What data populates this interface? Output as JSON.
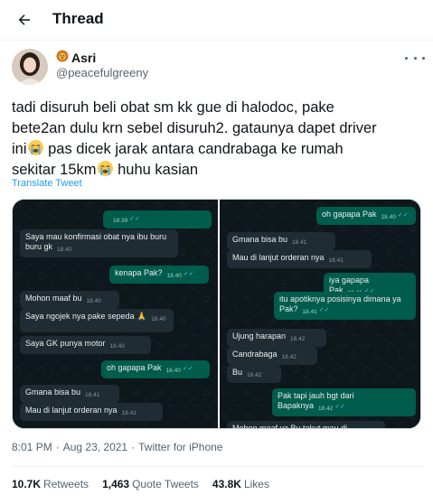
{
  "header": {
    "title": "Thread"
  },
  "author": {
    "name": "Asri",
    "handle": "@peacefulgreeny"
  },
  "tweet": {
    "text_line1": "tadi disuruh beli obat sm kk gue di halodoc, pake",
    "text_line2": "bete2an dulu krn sebel disuruh2. gataunya dapet driver",
    "text_line3_a": "ini",
    "text_line3_b": " pas dicek jarak antara candrabaga ke rumah",
    "text_line4_a": "sekitar 15km",
    "text_line4_b": " huhu kasian",
    "translate_label": "Translate Tweet"
  },
  "chat_left": [
    {
      "dir": "out",
      "text": "",
      "time": "18.39"
    },
    {
      "dir": "in",
      "text": "Saya mau konfirmasi obat nya ibu buru buru gk",
      "time": "18.40"
    },
    {
      "dir": "out",
      "text": "kenapa Pak?",
      "time": "18.40"
    },
    {
      "dir": "in",
      "text": "Mohon maaf bu",
      "time": "18.40"
    },
    {
      "dir": "in",
      "text": "Saya ngojek nya pake sepeda 🙏",
      "time": "18.40"
    },
    {
      "dir": "in",
      "text": "Saya GK punya motor",
      "time": "18.40"
    },
    {
      "dir": "out",
      "text": "oh gapapa Pak",
      "time": "18.40"
    },
    {
      "dir": "in",
      "text": "Gmana bisa bu",
      "time": "18.41"
    },
    {
      "dir": "in",
      "text": "Mau di lanjut orderan nya",
      "time": "18.41"
    }
  ],
  "chat_right": [
    {
      "dir": "out",
      "text": "oh gapapa Pak",
      "time": "18.40"
    },
    {
      "dir": "in",
      "text": "Gmana bisa bu",
      "time": "18.41"
    },
    {
      "dir": "in",
      "text": "Mau di lanjut orderan nya",
      "time": "18.41"
    },
    {
      "dir": "out",
      "text": "iya gapapa Pak",
      "time": "18.41"
    },
    {
      "dir": "out",
      "text": "itu apotiknya posisinya dimana ya Pak?",
      "time": "18.41"
    },
    {
      "dir": "in",
      "text": "Ujung harapan",
      "time": "18.42"
    },
    {
      "dir": "in",
      "text": "Candrabaga",
      "time": "18.42"
    },
    {
      "dir": "in",
      "text": "Bu",
      "time": "18.42"
    },
    {
      "dir": "out",
      "text": "Pak tapi jauh bgt dari Bapaknya",
      "time": "18.42"
    },
    {
      "dir": "in",
      "text": "Mohon maaf ya Bu takut mau di",
      "time": ""
    }
  ],
  "meta": {
    "time": "8:01 PM",
    "date": "Aug 23, 2021",
    "source": "Twitter for iPhone",
    "separator": "·"
  },
  "stats": {
    "retweets_count": "10.7K",
    "retweets_label": "Retweets",
    "quotes_count": "1,463",
    "quotes_label": "Quote Tweets",
    "likes_count": "43.8K",
    "likes_label": "Likes"
  },
  "colors": {
    "accent": "#1d9bf0",
    "text": "#0f1419",
    "muted": "#536471",
    "wa_in": "#202c33",
    "wa_out": "#005c4b"
  }
}
